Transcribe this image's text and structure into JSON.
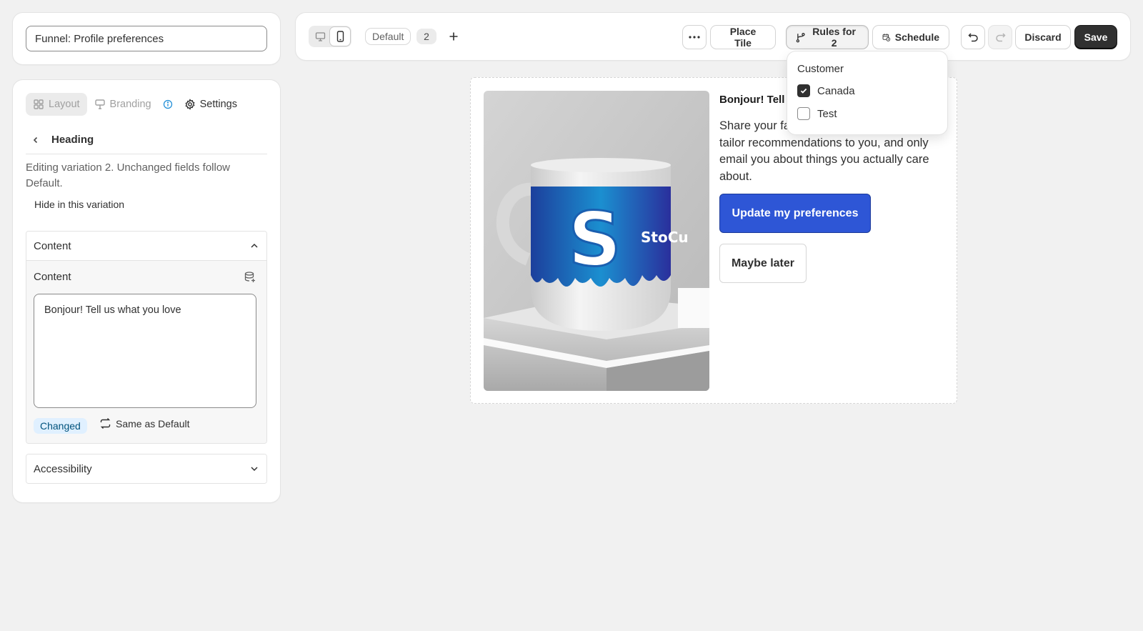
{
  "funnel": {
    "title_value": "Funnel: Profile preferences"
  },
  "editor": {
    "tabs": [
      {
        "label": "Layout",
        "icon": "layout-grid-icon"
      },
      {
        "label": "Branding",
        "icon": "paint-icon"
      },
      {
        "label": "Settings",
        "icon": "gear-icon"
      }
    ],
    "back_title": "Heading",
    "note": "Editing variation 2. Unchanged fields follow Default.",
    "hide_label": "Hide in this variation",
    "content_section": {
      "title": "Content",
      "field_label": "Content",
      "value": "Bonjour! Tell us what you love",
      "badge": "Changed",
      "reset_label": "Same as Default"
    },
    "accessibility_section": {
      "title": "Accessibility"
    }
  },
  "toolbar": {
    "variant_default": "Default",
    "variant_number": "2",
    "place_tile": "Place Tile",
    "rules": "Rules for 2",
    "schedule": "Schedule",
    "discard": "Discard",
    "save": "Save"
  },
  "rules_dropdown": {
    "title": "Customer",
    "options": [
      {
        "label": "Canada",
        "checked": true
      },
      {
        "label": "Test",
        "checked": false
      }
    ]
  },
  "preview": {
    "heading": "Bonjour! Tell u",
    "body": "Share your fa                         and we will tailor recommendations to you, and only email you about things you actually care about.",
    "primary_button": "Update my preferences",
    "secondary_button": "Maybe later",
    "mug_brand": "StoCu",
    "mug_letter": "S"
  },
  "colors": {
    "primary": "#2e56d6",
    "save_bg": "#303030",
    "changed_badge_bg": "#e0f0ff",
    "info_icon": "#1a8bd6"
  }
}
